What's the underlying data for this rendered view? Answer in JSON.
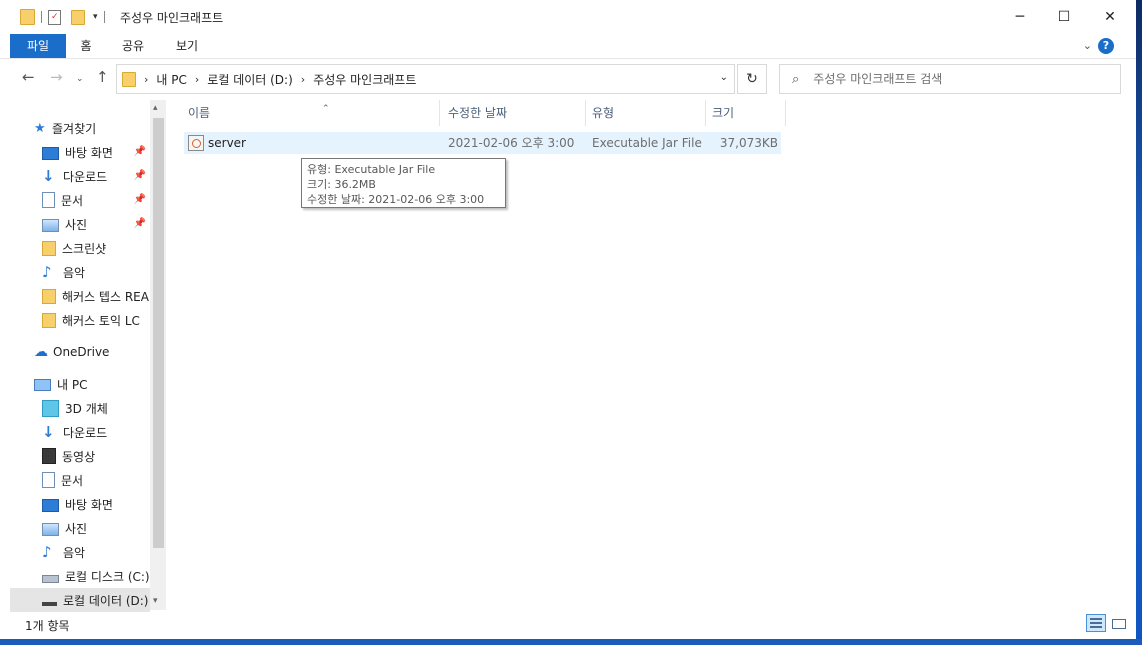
{
  "window": {
    "title": "주성우 마인크래프트",
    "controls": {
      "minimize": "─",
      "maximize": "☐",
      "close": "✕"
    }
  },
  "ribbon": {
    "tabs": [
      "파일",
      "홈",
      "공유",
      "보기"
    ],
    "help": "?"
  },
  "nav": {
    "back": "←",
    "forward": "→",
    "up": "↑",
    "breadcrumb": [
      "내 PC",
      "로컬 데이터 (D:)",
      "주성우 마인크래프트"
    ],
    "refresh": "↻",
    "search_placeholder": "주성우 마인크래프트 검색"
  },
  "sidebar": {
    "quick_access": "즐겨찾기",
    "quick_items": [
      {
        "label": "바탕 화면",
        "icon": "desktop-icon",
        "pinned": true
      },
      {
        "label": "다운로드",
        "icon": "download-icon",
        "pinned": true
      },
      {
        "label": "문서",
        "icon": "document-icon",
        "pinned": true
      },
      {
        "label": "사진",
        "icon": "pictures-icon",
        "pinned": true
      },
      {
        "label": "스크린샷",
        "icon": "folder-icon",
        "pinned": false
      },
      {
        "label": "음악",
        "icon": "music-icon",
        "pinned": false
      },
      {
        "label": "해커스 텝스 REA",
        "icon": "folder-icon",
        "pinned": false
      },
      {
        "label": "해커스 토익 LC",
        "icon": "folder-icon",
        "pinned": false
      }
    ],
    "onedrive": "OneDrive",
    "this_pc": "내 PC",
    "pc_items": [
      {
        "label": "3D 개체",
        "icon": "3d-objects-icon"
      },
      {
        "label": "다운로드",
        "icon": "download-icon"
      },
      {
        "label": "동영상",
        "icon": "video-icon"
      },
      {
        "label": "문서",
        "icon": "document-icon"
      },
      {
        "label": "바탕 화면",
        "icon": "desktop-icon"
      },
      {
        "label": "사진",
        "icon": "pictures-icon"
      },
      {
        "label": "음악",
        "icon": "music-icon"
      },
      {
        "label": "로컬 디스크 (C:)",
        "icon": "drive-icon"
      },
      {
        "label": "로컬 데이터 (D:)",
        "icon": "drive-icon"
      }
    ]
  },
  "columns": {
    "name": "이름",
    "modified": "수정한 날짜",
    "type": "유형",
    "size": "크기"
  },
  "files": [
    {
      "name": "server",
      "modified": "2021-02-06 오후 3:00",
      "type": "Executable Jar File",
      "size": "37,073KB"
    }
  ],
  "tooltip": {
    "line1": "유형: Executable Jar File",
    "line2": "크기: 36.2MB",
    "line3": "수정한 날짜: 2021-02-06 오후 3:00"
  },
  "status": {
    "count": "1개 항목"
  }
}
